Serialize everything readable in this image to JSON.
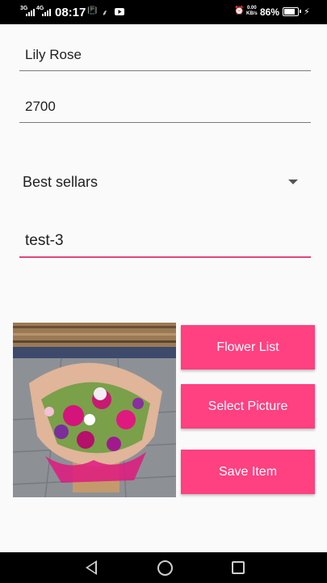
{
  "status_bar": {
    "sim1": "3G",
    "sim2": "4G",
    "time": "08:17",
    "net_speed_value": "0.00",
    "net_speed_unit": "KB/s",
    "battery": "86%",
    "battery_level": 0.86,
    "icons": [
      "vibrate-icon",
      "usb-icon",
      "youtube-icon",
      "alarm-icon",
      "charging-icon"
    ]
  },
  "form": {
    "name_value": "Lily Rose",
    "price_value": "2700",
    "category_selected": "Best sellars",
    "tag_value": "test-3"
  },
  "buttons": {
    "flower_list": "Flower List",
    "select_picture": "Select Picture",
    "save_item": "Save Item"
  },
  "colors": {
    "accent": "#ff4081",
    "underline_active": "#e0457b"
  },
  "nav_bar": {
    "icons": [
      "back-icon",
      "home-icon",
      "recents-icon"
    ]
  }
}
